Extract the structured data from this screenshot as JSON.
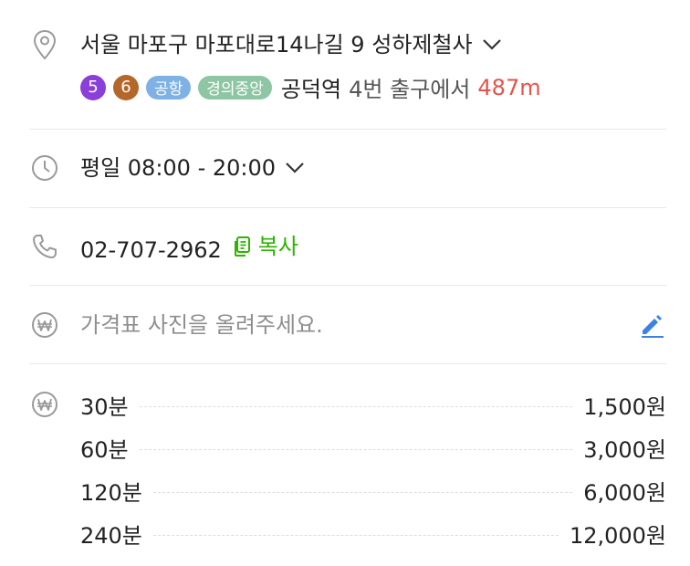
{
  "address": {
    "text": "서울 마포구 마포대로14나길 9 성하제철사",
    "icon": "location-pin-icon",
    "expand_icon": "chevron-down-icon"
  },
  "subway": {
    "lines": [
      {
        "label": "5",
        "color": "#8b3fd9",
        "shape": "circle"
      },
      {
        "label": "6",
        "color": "#b5662b",
        "shape": "circle"
      },
      {
        "label": "공항",
        "color": "#7fb1e4",
        "shape": "pill"
      },
      {
        "label": "경의중앙",
        "color": "#8ec6a4",
        "shape": "pill"
      }
    ],
    "station": "공덕역",
    "exit": "4번 출구에서",
    "distance": "487m"
  },
  "hours": {
    "text": "평일 08:00 - 20:00",
    "icon": "clock-icon",
    "expand_icon": "chevron-down-icon"
  },
  "phone": {
    "number": "02-707-2962",
    "icon": "phone-icon",
    "copy_label": "복사",
    "copy_icon": "copy-icon"
  },
  "price_photo": {
    "placeholder": "가격표 사진을 올려주세요.",
    "icon": "won-icon",
    "edit_icon": "pencil-icon"
  },
  "prices": {
    "icon": "won-icon",
    "items": [
      {
        "label": "30분",
        "value": "1,500원"
      },
      {
        "label": "60분",
        "value": "3,000원"
      },
      {
        "label": "120분",
        "value": "6,000원"
      },
      {
        "label": "240분",
        "value": "12,000원"
      }
    ]
  },
  "colors": {
    "accent_green": "#2db400",
    "distance_red": "#e5534b",
    "edit_blue": "#3b82e6"
  }
}
